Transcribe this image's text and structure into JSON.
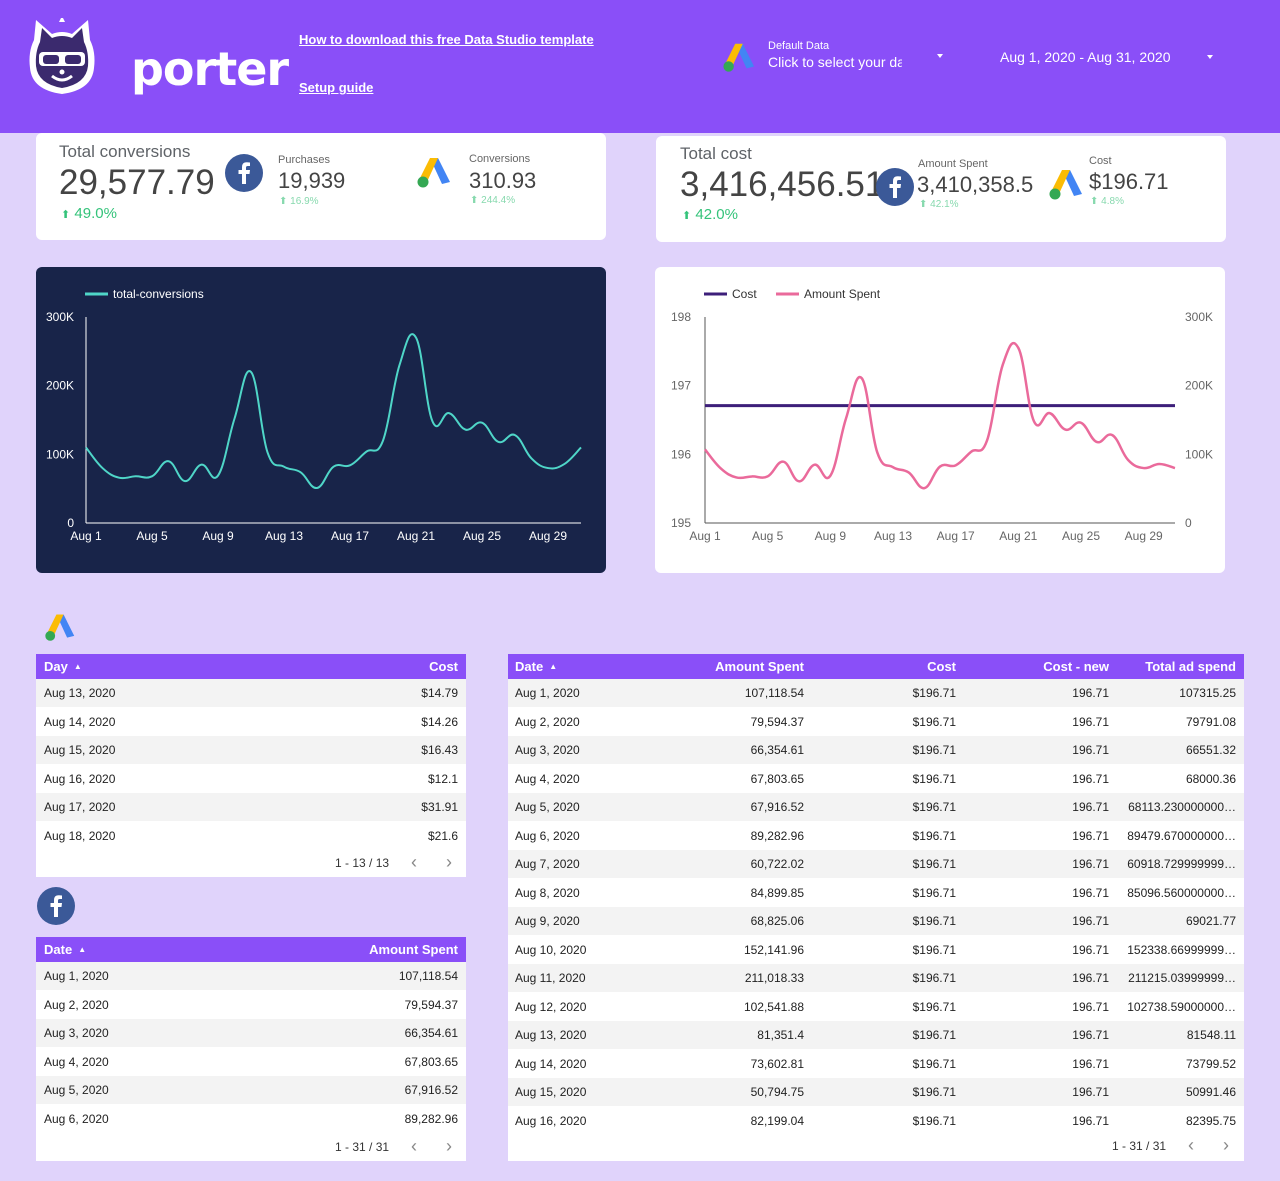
{
  "header": {
    "logo_text": "porter",
    "link_download": "How to download this free Data Studio template",
    "link_setup": "Setup guide",
    "data_control_label": "Default Data",
    "data_control_value": "Click to select your data",
    "date_range": "Aug 1, 2020 - Aug 31, 2020"
  },
  "kpi_conversions": {
    "title": "Total conversions",
    "value": "29,577.79",
    "delta": "49.0%",
    "fb_label": "Purchases",
    "fb_value": "19,939",
    "fb_delta": "16.9%",
    "ga_label": "Conversions",
    "ga_value": "310.93",
    "ga_delta": "244.4%"
  },
  "kpi_cost": {
    "title": "Total cost",
    "value": "3,416,456.51",
    "delta": "42.0%",
    "fb_label": "Amount Spent",
    "fb_value": "3,410,358.5",
    "fb_delta": "42.1%",
    "ga_label": "Cost",
    "ga_value": "$196.71",
    "ga_delta": "4.8%"
  },
  "colors": {
    "header": "#8a4ff8",
    "background": "#e0d3fb",
    "conversions_line": "#4fd6c8",
    "cost_line": "#3d1f7a",
    "amount_spent_line": "#ea6a9b",
    "delta_green": "#34c37a"
  },
  "chart_data": [
    {
      "type": "line",
      "series": [
        {
          "name": "total-conversions",
          "x": [
            "Aug 1",
            "Aug 2",
            "Aug 3",
            "Aug 4",
            "Aug 5",
            "Aug 6",
            "Aug 7",
            "Aug 8",
            "Aug 9",
            "Aug 10",
            "Aug 11",
            "Aug 12",
            "Aug 13",
            "Aug 14",
            "Aug 15",
            "Aug 16",
            "Aug 17",
            "Aug 18",
            "Aug 19",
            "Aug 20",
            "Aug 21",
            "Aug 22",
            "Aug 23",
            "Aug 24",
            "Aug 25",
            "Aug 26",
            "Aug 27",
            "Aug 28",
            "Aug 29",
            "Aug 30",
            "Aug 31"
          ],
          "values": [
            110000,
            80000,
            66000,
            68000,
            68000,
            90000,
            61000,
            85000,
            69000,
            152000,
            220000,
            103000,
            82000,
            74000,
            51000,
            82000,
            84000,
            104000,
            120000,
            230000,
            270000,
            148000,
            160000,
            136000,
            146000,
            118000,
            128000,
            94000,
            80000,
            86000,
            110000
          ]
        }
      ],
      "x_ticks": [
        "Aug 1",
        "Aug 5",
        "Aug 9",
        "Aug 13",
        "Aug 17",
        "Aug 21",
        "Aug 25",
        "Aug 29"
      ],
      "y_ticks": [
        "0",
        "100K",
        "200K",
        "300K"
      ],
      "ylim": [
        0,
        300000
      ]
    },
    {
      "type": "line",
      "series": [
        {
          "name": "Cost",
          "axis": "left",
          "values": [
            196.71,
            196.71,
            196.71,
            196.71,
            196.71,
            196.71,
            196.71,
            196.71,
            196.71,
            196.71,
            196.71,
            196.71,
            196.71,
            196.71,
            196.71,
            196.71,
            196.71,
            196.71,
            196.71,
            196.71,
            196.71,
            196.71,
            196.71,
            196.71,
            196.71,
            196.71,
            196.71,
            196.71,
            196.71,
            196.71,
            196.71
          ]
        },
        {
          "name": "Amount Spent",
          "axis": "right",
          "values": [
            107118.54,
            79594.37,
            66354.61,
            67803.65,
            67916.52,
            89282.96,
            60722.02,
            84899.85,
            68825.06,
            152141.96,
            211018.33,
            102541.88,
            81351.4,
            73602.81,
            50794.75,
            82199.04,
            84000,
            104000,
            120000,
            230000,
            255000,
            148000,
            160000,
            136000,
            146000,
            118000,
            128000,
            92000,
            80000,
            86000,
            80000
          ]
        }
      ],
      "x_ticks": [
        "Aug 1",
        "Aug 5",
        "Aug 9",
        "Aug 13",
        "Aug 17",
        "Aug 21",
        "Aug 25",
        "Aug 29"
      ],
      "y_ticks_left": [
        "195",
        "196",
        "197",
        "198"
      ],
      "y_ticks_right": [
        "0",
        "100K",
        "200K",
        "300K"
      ],
      "ylim_left": [
        195,
        198
      ],
      "ylim_right": [
        0,
        300000
      ]
    }
  ],
  "table_ga": {
    "headers": [
      "Day",
      "Cost"
    ],
    "rows": [
      [
        "Aug 13, 2020",
        "$14.79"
      ],
      [
        "Aug 14, 2020",
        "$14.26"
      ],
      [
        "Aug 15, 2020",
        "$16.43"
      ],
      [
        "Aug 16, 2020",
        "$12.1"
      ],
      [
        "Aug 17, 2020",
        "$31.91"
      ],
      [
        "Aug 18, 2020",
        "$21.6"
      ]
    ],
    "pager": "1 - 13 / 13"
  },
  "table_fb": {
    "headers": [
      "Date",
      "Amount Spent"
    ],
    "rows": [
      [
        "Aug 1, 2020",
        "107,118.54"
      ],
      [
        "Aug 2, 2020",
        "79,594.37"
      ],
      [
        "Aug 3, 2020",
        "66,354.61"
      ],
      [
        "Aug 4, 2020",
        "67,803.65"
      ],
      [
        "Aug 5, 2020",
        "67,916.52"
      ],
      [
        "Aug 6, 2020",
        "89,282.96"
      ]
    ],
    "pager": "1 - 31 / 31"
  },
  "table_combined": {
    "headers": [
      "Date",
      "Amount Spent",
      "Cost",
      "Cost - new",
      "Total ad spend"
    ],
    "rows": [
      [
        "Aug 1, 2020",
        "107,118.54",
        "$196.71",
        "196.71",
        "107315.25"
      ],
      [
        "Aug 2, 2020",
        "79,594.37",
        "$196.71",
        "196.71",
        "79791.08"
      ],
      [
        "Aug 3, 2020",
        "66,354.61",
        "$196.71",
        "196.71",
        "66551.32"
      ],
      [
        "Aug 4, 2020",
        "67,803.65",
        "$196.71",
        "196.71",
        "68000.36"
      ],
      [
        "Aug 5, 2020",
        "67,916.52",
        "$196.71",
        "196.71",
        "68113.230000000…"
      ],
      [
        "Aug 6, 2020",
        "89,282.96",
        "$196.71",
        "196.71",
        "89479.670000000…"
      ],
      [
        "Aug 7, 2020",
        "60,722.02",
        "$196.71",
        "196.71",
        "60918.729999999…"
      ],
      [
        "Aug 8, 2020",
        "84,899.85",
        "$196.71",
        "196.71",
        "85096.560000000…"
      ],
      [
        "Aug 9, 2020",
        "68,825.06",
        "$196.71",
        "196.71",
        "69021.77"
      ],
      [
        "Aug 10, 2020",
        "152,141.96",
        "$196.71",
        "196.71",
        "152338.66999999…"
      ],
      [
        "Aug 11, 2020",
        "211,018.33",
        "$196.71",
        "196.71",
        "211215.03999999…"
      ],
      [
        "Aug 12, 2020",
        "102,541.88",
        "$196.71",
        "196.71",
        "102738.59000000…"
      ],
      [
        "Aug 13, 2020",
        "81,351.4",
        "$196.71",
        "196.71",
        "81548.11"
      ],
      [
        "Aug 14, 2020",
        "73,602.81",
        "$196.71",
        "196.71",
        "73799.52"
      ],
      [
        "Aug 15, 2020",
        "50,794.75",
        "$196.71",
        "196.71",
        "50991.46"
      ],
      [
        "Aug 16, 2020",
        "82,199.04",
        "$196.71",
        "196.71",
        "82395.75"
      ]
    ],
    "pager": "1 - 31 / 31"
  },
  "icons": {
    "brand": "porter-cat-logo",
    "facebook": "facebook-icon",
    "google_ads": "google-ads-icon",
    "pager_prev": "chevron-left-icon",
    "pager_next": "chevron-right-icon",
    "sort": "sort-ascending-icon"
  }
}
